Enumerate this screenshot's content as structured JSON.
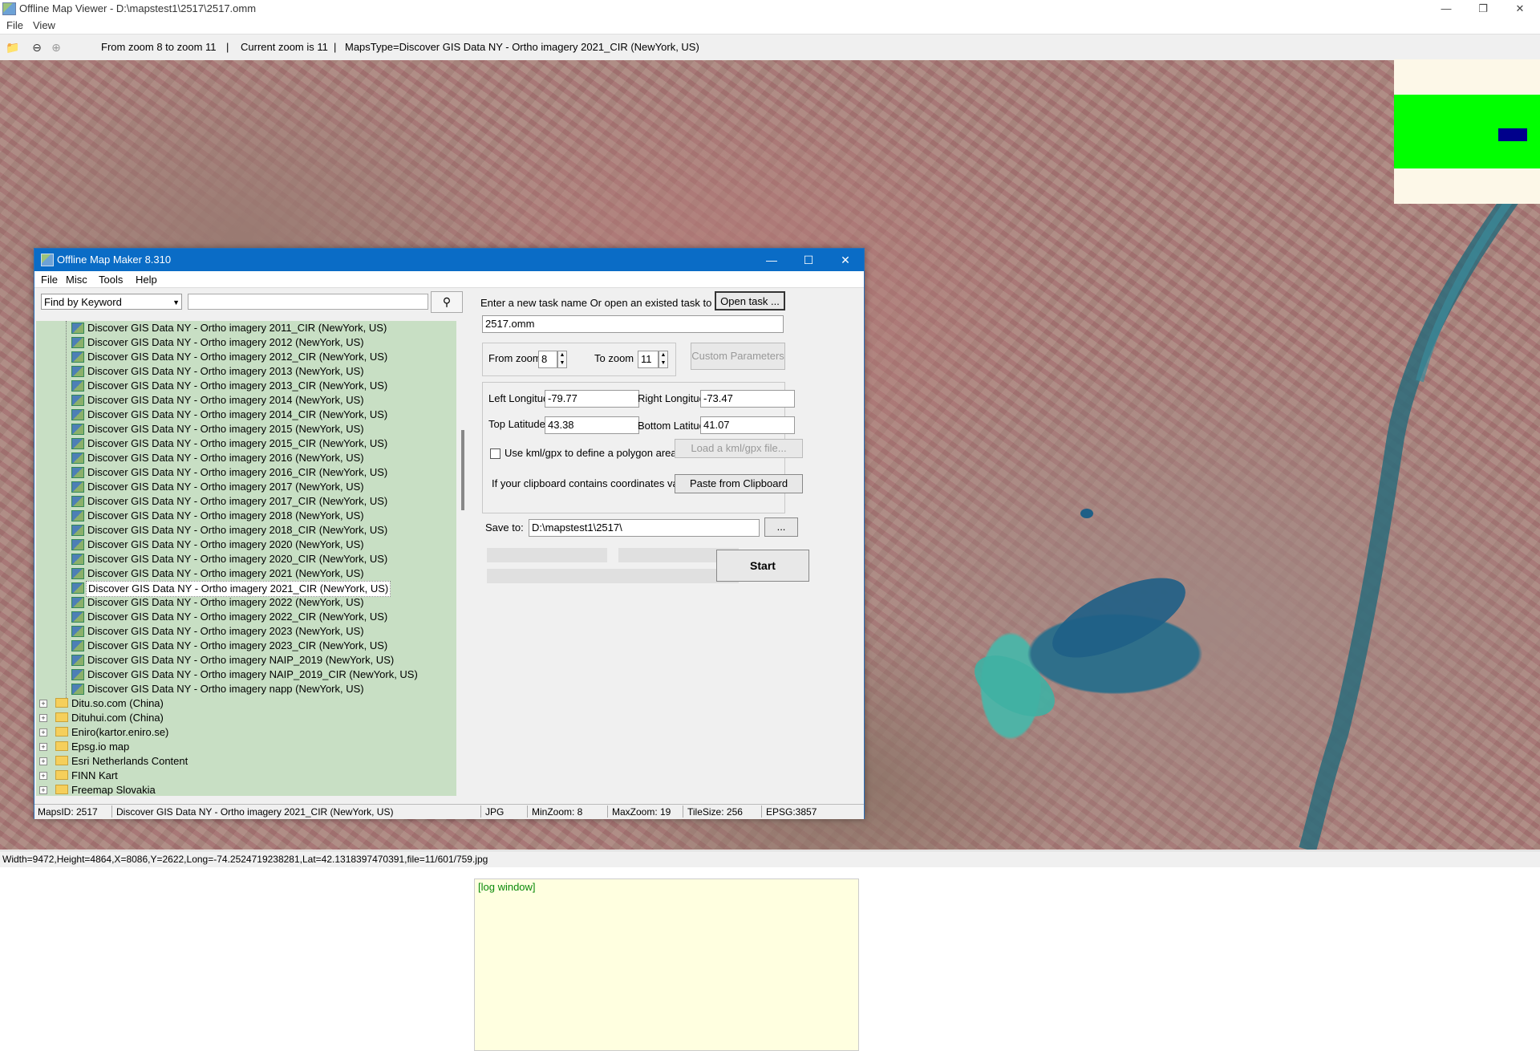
{
  "window": {
    "title": "Offline Map Viewer - D:\\mapstest1\\2517\\2517.omm"
  },
  "menu": {
    "file": "File",
    "view": "View"
  },
  "toolbar": {
    "zoom_range": "From zoom 8 to zoom 11",
    "current_zoom": "Current zoom is 11",
    "maps_type": "MapsType=Discover GIS Data NY - Ortho imagery 2021_CIR (NewYork, US)"
  },
  "statusbar": {
    "text": "Width=9472,Height=4864,X=8086,Y=2622,Long=-74.2524719238281,Lat=42.1318397470391,file=11/601/759.jpg"
  },
  "dialog": {
    "title": "Offline Map Maker 8.310",
    "menu": [
      "File",
      "Misc",
      "Tools",
      "Help"
    ],
    "search": {
      "mode": "Find by Keyword",
      "value": ""
    },
    "tree": {
      "map_items": [
        "Discover GIS Data NY - Ortho imagery 2011_CIR (NewYork, US)",
        "Discover GIS Data NY - Ortho imagery 2012 (NewYork, US)",
        "Discover GIS Data NY - Ortho imagery 2012_CIR (NewYork, US)",
        "Discover GIS Data NY - Ortho imagery 2013 (NewYork, US)",
        "Discover GIS Data NY - Ortho imagery 2013_CIR (NewYork, US)",
        "Discover GIS Data NY - Ortho imagery 2014 (NewYork, US)",
        "Discover GIS Data NY - Ortho imagery 2014_CIR (NewYork, US)",
        "Discover GIS Data NY - Ortho imagery 2015 (NewYork, US)",
        "Discover GIS Data NY - Ortho imagery 2015_CIR (NewYork, US)",
        "Discover GIS Data NY - Ortho imagery 2016 (NewYork, US)",
        "Discover GIS Data NY - Ortho imagery 2016_CIR (NewYork, US)",
        "Discover GIS Data NY - Ortho imagery 2017 (NewYork, US)",
        "Discover GIS Data NY - Ortho imagery 2017_CIR (NewYork, US)",
        "Discover GIS Data NY - Ortho imagery 2018 (NewYork, US)",
        "Discover GIS Data NY - Ortho imagery 2018_CIR (NewYork, US)",
        "Discover GIS Data NY - Ortho imagery 2020 (NewYork, US)",
        "Discover GIS Data NY - Ortho imagery 2020_CIR (NewYork, US)",
        "Discover GIS Data NY - Ortho imagery 2021 (NewYork, US)",
        "Discover GIS Data NY - Ortho imagery 2021_CIR (NewYork, US)",
        "Discover GIS Data NY - Ortho imagery 2022 (NewYork, US)",
        "Discover GIS Data NY - Ortho imagery 2022_CIR (NewYork, US)",
        "Discover GIS Data NY - Ortho imagery 2023 (NewYork, US)",
        "Discover GIS Data NY - Ortho imagery 2023_CIR (NewYork, US)",
        "Discover GIS Data NY - Ortho imagery NAIP_2019 (NewYork, US)",
        "Discover GIS Data NY - Ortho imagery NAIP_2019_CIR (NewYork, US)",
        "Discover GIS Data NY - Ortho imagery napp (NewYork, US)"
      ],
      "selected_index": 18,
      "folders": [
        "Ditu.so.com (China)",
        "Dituhui.com (China)",
        "Eniro(kartor.eniro.se)",
        "Epsg.io map",
        "Esri Netherlands Content",
        "FINN Kart",
        "Freemap Slovakia"
      ]
    },
    "task": {
      "prompt": "Enter a new task name Or open an existed task to continue:",
      "open_label": "Open task ...",
      "name": "2517.omm"
    },
    "zoom": {
      "from_label": "From zoom",
      "from_value": "8",
      "to_label": "To zoom",
      "to_value": "11",
      "custom_label": "Custom Parameters"
    },
    "coords": {
      "left_lon_label": "Left Longitude",
      "left_lon": "-79.77",
      "right_lon_label": "Right Longitude",
      "right_lon": "-73.47",
      "top_lat_label": "Top Latitude",
      "top_lat": "43.38",
      "bottom_lat_label": "Bottom Latitude",
      "bottom_lat": "41.07",
      "kml_label": "Use kml/gpx to define a polygon area",
      "load_kml_label": "Load a kml/gpx file...",
      "clipboard_label": "If your clipboard contains coordinates values:",
      "paste_label": "Paste from Clipboard"
    },
    "save": {
      "label": "Save to:",
      "path": "D:\\mapstest1\\2517\\",
      "browse": "..."
    },
    "start_label": "Start",
    "log_text": "[log window]",
    "status": {
      "maps_id": "MapsID: 2517",
      "name": "Discover GIS Data NY - Ortho imagery 2021_CIR (NewYork, US)",
      "format": "JPG",
      "min_zoom": "MinZoom: 8",
      "max_zoom": "MaxZoom: 19",
      "tile_size": "TileSize: 256",
      "epsg": "EPSG:3857"
    }
  }
}
